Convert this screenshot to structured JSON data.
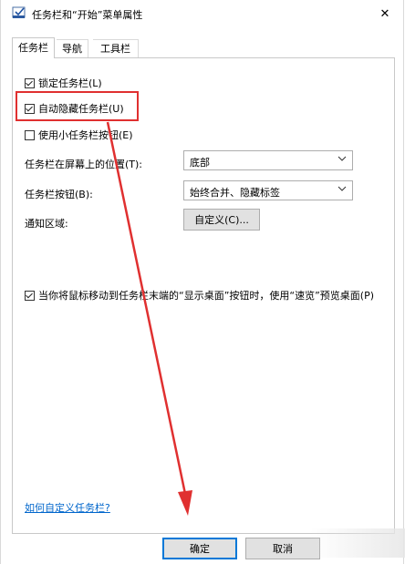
{
  "window": {
    "title": "任务栏和“开始”菜单属性",
    "close_symbol": "✕"
  },
  "tabs": [
    {
      "label": "任务栏",
      "active": true
    },
    {
      "label": "导航",
      "active": false
    },
    {
      "label": "工具栏",
      "active": false
    }
  ],
  "taskbar": {
    "lock_taskbar": {
      "label": "锁定任务栏(L)",
      "checked": true
    },
    "auto_hide": {
      "label": "自动隐藏任务栏(U)",
      "checked": true
    },
    "small_buttons": {
      "label": "使用小任务栏按钮(E)",
      "checked": false
    },
    "location_label": "任务栏在屏幕上的位置(T):",
    "location_value": "底部",
    "buttons_label": "任务栏按钮(B):",
    "buttons_value": "始终合并、隐藏标签",
    "notification_label": "通知区域:",
    "customize_button": "自定义(C)...",
    "peek": {
      "label": "当你将鼠标移动到任务栏末端的“显示桌面”按钮时，使用“速览”预览桌面(P)",
      "checked": true
    },
    "help_link": "如何自定义任务栏?"
  },
  "footer": {
    "ok": "确定",
    "cancel": "取消"
  },
  "annotation": {
    "highlight_color": "#e03030"
  }
}
